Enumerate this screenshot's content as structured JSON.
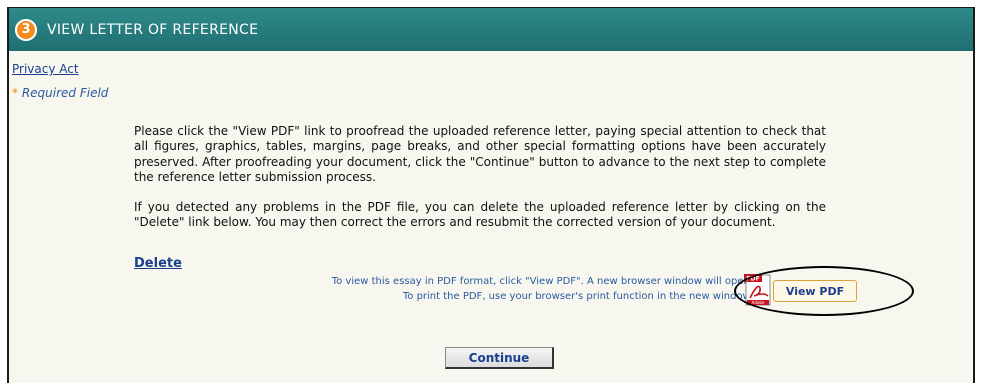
{
  "header": {
    "step_number": "3",
    "title": "VIEW LETTER OF REFERENCE"
  },
  "links": {
    "privacy_act": "Privacy Act",
    "delete": "Delete"
  },
  "required_field": {
    "marker": "*",
    "label": "Required Field"
  },
  "instructions": {
    "paragraph_1": "Please click the \"View PDF\" link to proofread the uploaded reference letter, paying special attention to check that all figures, graphics, tables, margins, page breaks, and other special formatting options have been accurately preserved. After proofreading your document, click the \"Continue\" button to advance to the next step to complete the reference letter submission process.",
    "paragraph_2": "If you detected any problems in the PDF file, you can delete the uploaded reference letter by clicking on the \"Delete\" link below. You may then correct the errors and resubmit the corrected version of your document."
  },
  "pdf_hint": {
    "line_1": "To view this essay in PDF format, click \"View PDF\". A new browser window will open.",
    "line_2": "To print the PDF, use your browser's print function in the new window."
  },
  "buttons": {
    "view_pdf": "View PDF",
    "continue": "Continue"
  },
  "icons": {
    "pdf": "adobe-pdf-icon",
    "badge_label": "PDF",
    "badge_brand": "Adobe"
  },
  "colors": {
    "header": "#1f6f72",
    "badge": "#f28c1e",
    "link": "#1a3f8f",
    "background": "#f7f7ef"
  }
}
